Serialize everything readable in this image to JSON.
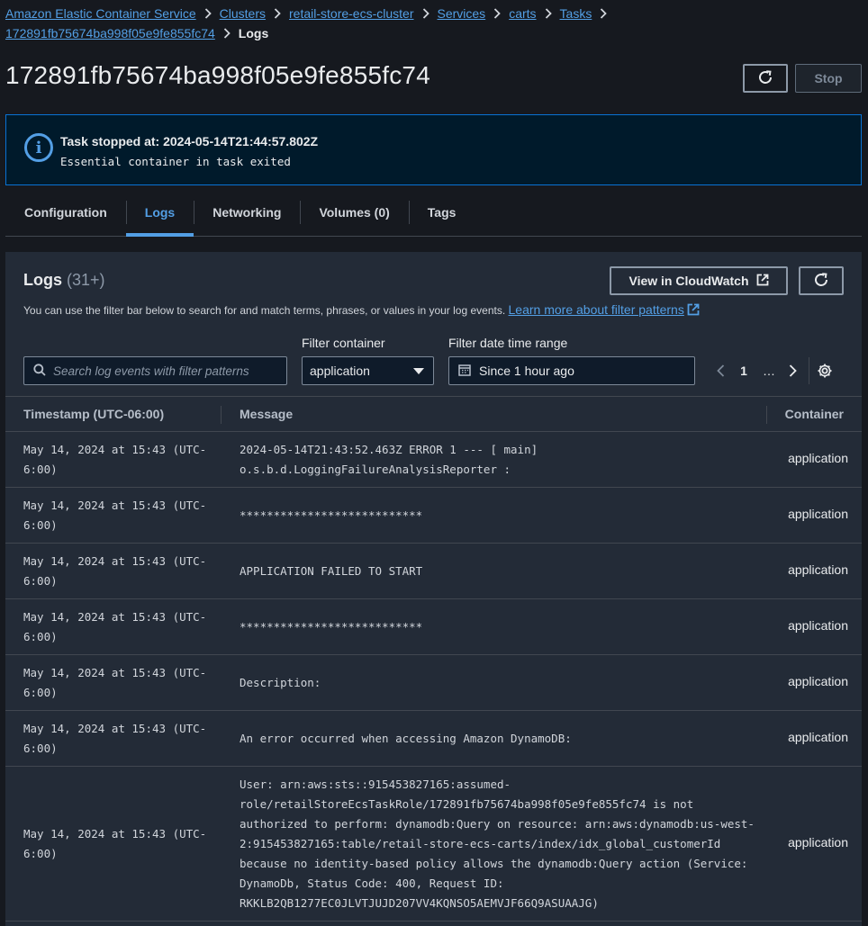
{
  "breadcrumb": {
    "items": [
      "Amazon Elastic Container Service",
      "Clusters",
      "retail-store-ecs-cluster",
      "Services",
      "carts",
      "Tasks",
      "172891fb75674ba998f05e9fe855fc74"
    ],
    "current": "Logs"
  },
  "header": {
    "title": "172891fb75674ba998f05e9fe855fc74",
    "stop_label": "Stop"
  },
  "alert": {
    "title": "Task stopped at: 2024-05-14T21:44:57.802Z",
    "message": "Essential container in task exited"
  },
  "tabs": [
    {
      "label": "Configuration",
      "active": false
    },
    {
      "label": "Logs",
      "active": true
    },
    {
      "label": "Networking",
      "active": false
    },
    {
      "label": "Volumes (0)",
      "active": false
    },
    {
      "label": "Tags",
      "active": false
    }
  ],
  "logs_panel": {
    "title": "Logs",
    "count": "(31+)",
    "description": "You can use the filter bar below to search for and match terms, phrases, or values in your log events.",
    "learn_more": "Learn more about filter patterns",
    "cloudwatch_label": "View in CloudWatch",
    "search_placeholder": "Search log events with filter patterns",
    "filter_container_label": "Filter container",
    "filter_container_value": "application",
    "filter_date_label": "Filter date time range",
    "filter_date_value": "Since 1 hour ago",
    "page": "1",
    "ellipsis": "…"
  },
  "table": {
    "columns": [
      "Timestamp (UTC-06:00)",
      "Message",
      "Container"
    ],
    "rows": [
      {
        "timestamp": "May 14, 2024 at 15:43 (UTC-6:00)",
        "message": "2024-05-14T21:43:52.463Z ERROR 1 --- [ main] o.s.b.d.LoggingFailureAnalysisReporter :",
        "container": "application"
      },
      {
        "timestamp": "May 14, 2024 at 15:43 (UTC-6:00)",
        "message": "***************************",
        "container": "application"
      },
      {
        "timestamp": "May 14, 2024 at 15:43 (UTC-6:00)",
        "message": "APPLICATION FAILED TO START",
        "container": "application"
      },
      {
        "timestamp": "May 14, 2024 at 15:43 (UTC-6:00)",
        "message": "***************************",
        "container": "application"
      },
      {
        "timestamp": "May 14, 2024 at 15:43 (UTC-6:00)",
        "message": "Description:",
        "container": "application"
      },
      {
        "timestamp": "May 14, 2024 at 15:43 (UTC-6:00)",
        "message": "An error occurred when accessing Amazon DynamoDB:",
        "container": "application"
      },
      {
        "timestamp": "May 14, 2024 at 15:43 (UTC-6:00)",
        "message": "User: arn:aws:sts::915453827165:assumed-role/retailStoreEcsTaskRole/172891fb75674ba998f05e9fe855fc74 is not authorized to perform: dynamodb:Query on resource: arn:aws:dynamodb:us-west-2:915453827165:table/retail-store-ecs-carts/index/idx_global_customerId because no identity-based policy allows the dynamodb:Query action (Service: DynamoDb, Status Code: 400, Request ID: RKKLB2QB1277EC0JLVTJUJD207VV4KQNSO5AEMVJF66Q9ASUAAJG)",
        "container": "application"
      }
    ]
  },
  "colors": {
    "link": "#539fe5",
    "background": "#16191f",
    "panel": "#232b37",
    "alert_bg": "#001a2b",
    "alert_border": "#0972d3"
  },
  "icons": [
    "chevron-right-icon",
    "refresh-icon",
    "info-icon",
    "external-link-icon",
    "search-icon",
    "caret-down-icon",
    "calendar-icon",
    "chevron-left-icon",
    "settings-icon"
  ]
}
